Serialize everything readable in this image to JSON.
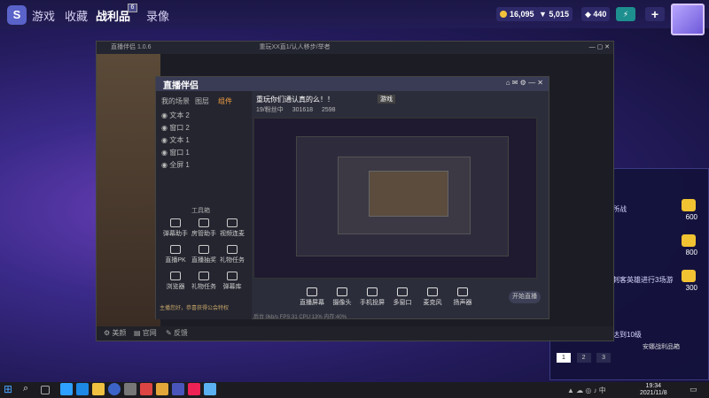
{
  "topnav": {
    "items": [
      "游戏",
      "收藏",
      "战利品",
      "录像"
    ],
    "badge": "6",
    "coins": "16,095",
    "rank": "5,015",
    "gems": "440",
    "plus_icon": "plus-icon"
  },
  "right_panel": {
    "rows": [
      {
        "text": "所战",
        "value": "600"
      },
      {
        "text": "",
        "value": "800"
      },
      {
        "text": "刺客英雄进行3场游",
        "value": "300"
      },
      {
        "text": "达到10级",
        "value": ""
      }
    ],
    "reward_title": "安娜战利品箱",
    "pages": [
      "1",
      "2",
      "3"
    ]
  },
  "window": {
    "title": "直播伴侣 1.0.6",
    "title_center": "重玩XX直1/认人移步/举者",
    "status_left": "美颜",
    "status_mid": "官网",
    "status_right": "反馈"
  },
  "app": {
    "logo": "直播伴侣",
    "tabs": [
      "我的场景",
      "图层",
      "组件"
    ],
    "scenes": [
      "文本 2",
      "窗口 2",
      "文本 1",
      "窗口 1",
      "全屏 1"
    ],
    "tools_title": "工具箱",
    "tools": [
      "弹幕助手",
      "房管助手",
      "视频连麦",
      "直播PK",
      "直播抽奖",
      "礼物任务",
      "浏览器",
      "礼物任务",
      "弹幕库"
    ],
    "stream_title": "重玩你们通认真的么！！",
    "stream_badge": "游戏",
    "stat_fans": "19/粉丝中",
    "stat_views": "301618",
    "stat_likes": "2598",
    "controls": [
      "直播屏幕",
      "摄像头",
      "手机投屏",
      "多窗口",
      "麦克风",
      "扬声器"
    ],
    "go_live": "开始直播",
    "notice": "主播您好，恭喜获得公会特权",
    "footer_stats": "后台 0kb/s  FPS:31  CPU:13%  内存:40%"
  },
  "taskbar": {
    "time": "19:34",
    "date": "2021/11/8",
    "start_icon": "windows-start-icon",
    "search_icon": "search-icon"
  },
  "colors": {
    "accent": "#f2a043",
    "brand": "#5a63c9",
    "gold": "#f4c23a"
  }
}
